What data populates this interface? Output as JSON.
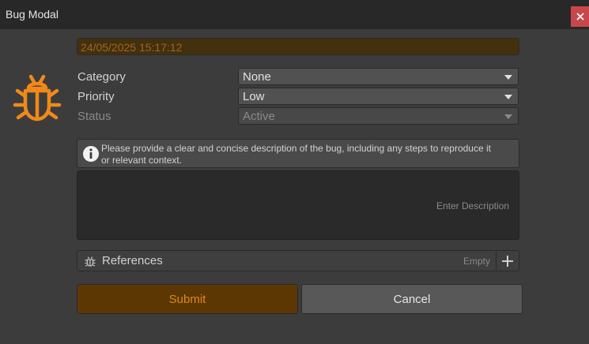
{
  "window": {
    "title": "Bug Modal"
  },
  "datetime": "24/05/2025 15:17:12",
  "fields": {
    "category": {
      "label": "Category",
      "value": "None"
    },
    "priority": {
      "label": "Priority",
      "value": "Low"
    },
    "status": {
      "label": "Status",
      "value": "Active"
    }
  },
  "help": {
    "text": "Please provide a clear and concise description of the bug, including any steps to reproduce it or relevant context."
  },
  "description": {
    "placeholder": "Enter Description"
  },
  "references": {
    "label": "References",
    "count_text": "Empty"
  },
  "buttons": {
    "submit": "Submit",
    "cancel": "Cancel"
  },
  "colors": {
    "accent": "#f0891a",
    "titlebar": "#282828",
    "close": "#c8474b"
  },
  "icons": {
    "header": "bug-icon",
    "info": "info-icon",
    "references": "bug-small-icon",
    "add": "plus-icon",
    "close": "close-icon"
  }
}
